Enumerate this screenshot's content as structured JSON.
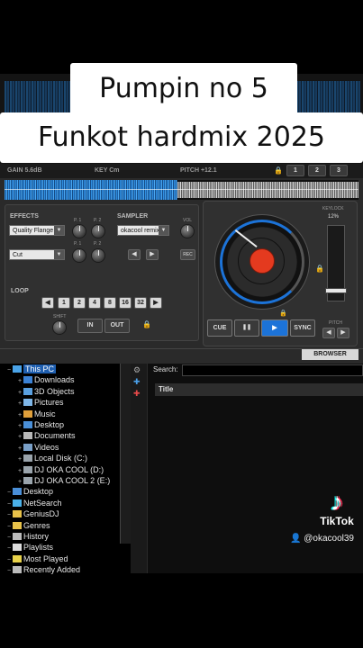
{
  "overlay": {
    "caption_line1": "Pumpin no 5",
    "caption_line2": "Funkot hardmix 2025",
    "brand": "TikTok",
    "brand_icon": "tiktok-logo-icon",
    "user": "@okacool39",
    "user_icon": "person-icon"
  },
  "deck": {
    "gain_label": "GAIN 5.6dB",
    "key_label": "KEY Cm",
    "pitch_label": "PITCH +12.1",
    "pitch_buttons": [
      "1",
      "2",
      "3"
    ],
    "keylock_label": "KEYLOCK",
    "keylock_value": "12%",
    "pitch_slider_label": "PITCH",
    "jog_accent": "#1c73d8",
    "jog_center_color": "#e43a1f"
  },
  "effects": {
    "label": "EFFECTS",
    "param_labels": [
      "P. 1",
      "P. 2",
      "P. 1",
      "P. 2"
    ],
    "effect1": "Quality Flange",
    "effect2": "Cut"
  },
  "sampler": {
    "label": "SAMPLER",
    "vol_label": "VOL",
    "sample": "okacool remix",
    "rec_label": "REC"
  },
  "loop": {
    "label": "LOOP",
    "sizes": [
      "1",
      "2",
      "4",
      "8",
      "16",
      "32"
    ],
    "shift_label": "SHIFT",
    "in_label": "IN",
    "out_label": "OUT"
  },
  "transport": {
    "cue": "CUE",
    "pause": "❚❚",
    "play": "▶",
    "sync": "SYNC"
  },
  "browser": {
    "tab_label": "BROWSER",
    "search_label": "Search:",
    "search_value": "",
    "column_title": "Title",
    "tree": [
      {
        "label": "This PC",
        "icon": "computer-icon",
        "selected": true
      },
      {
        "label": "Downloads",
        "icon": "download-icon"
      },
      {
        "label": "3D Objects",
        "icon": "cube-icon"
      },
      {
        "label": "Pictures",
        "icon": "picture-icon"
      },
      {
        "label": "Music",
        "icon": "music-icon"
      },
      {
        "label": "Desktop",
        "icon": "monitor-icon"
      },
      {
        "label": "Documents",
        "icon": "document-icon"
      },
      {
        "label": "Videos",
        "icon": "video-icon"
      },
      {
        "label": "Local Disk (C:)",
        "icon": "drive-icon"
      },
      {
        "label": "DJ OKA COOL (D:)",
        "icon": "drive-icon"
      },
      {
        "label": "DJ OKA COOL 2 (E:)",
        "icon": "drive-icon"
      },
      {
        "label": "Desktop",
        "icon": "monitor-icon"
      },
      {
        "label": "NetSearch",
        "icon": "globe-icon"
      },
      {
        "label": "GeniusDJ",
        "icon": "folder-icon"
      },
      {
        "label": "Genres",
        "icon": "folder-icon"
      },
      {
        "label": "History",
        "icon": "history-icon"
      },
      {
        "label": "Playlists",
        "icon": "playlist-icon"
      },
      {
        "label": "Most Played",
        "icon": "star-icon"
      },
      {
        "label": "Recently Added",
        "icon": "clock-icon"
      }
    ]
  }
}
